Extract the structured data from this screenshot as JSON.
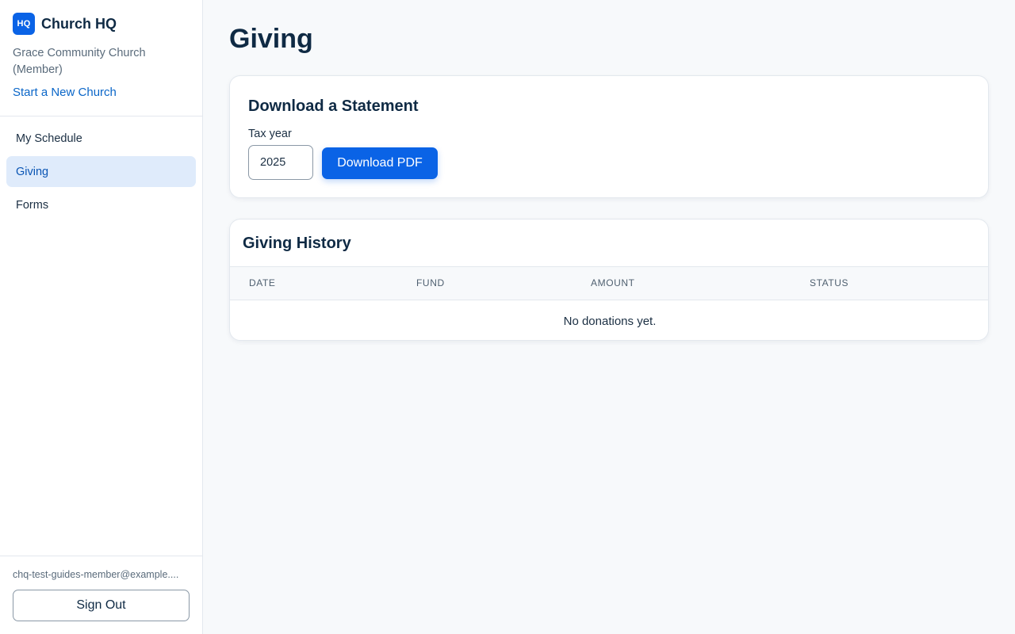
{
  "sidebar": {
    "logo_text": "HQ",
    "app_name": "Church HQ",
    "church_name": "Grace Community Church (Member)",
    "new_church_link": "Start a New Church",
    "nav_items": [
      {
        "label": "My Schedule",
        "active": false
      },
      {
        "label": "Giving",
        "active": true
      },
      {
        "label": "Forms",
        "active": false
      }
    ],
    "user_email": "chq-test-guides-member@example....",
    "sign_out_label": "Sign Out"
  },
  "main": {
    "page_title": "Giving",
    "statement": {
      "title": "Download a Statement",
      "tax_year_label": "Tax year",
      "tax_year_value": "2025",
      "download_button": "Download PDF"
    },
    "history": {
      "title": "Giving History",
      "columns": [
        "Date",
        "Fund",
        "Amount",
        "Status"
      ],
      "rows": [],
      "empty_message": "No donations yet."
    }
  },
  "colors": {
    "accent": "#0a63e6",
    "active_nav_bg": "#dfebfb",
    "link": "#0a66c8",
    "page_bg": "#f7f9fb",
    "text_primary": "#0f2a44"
  }
}
